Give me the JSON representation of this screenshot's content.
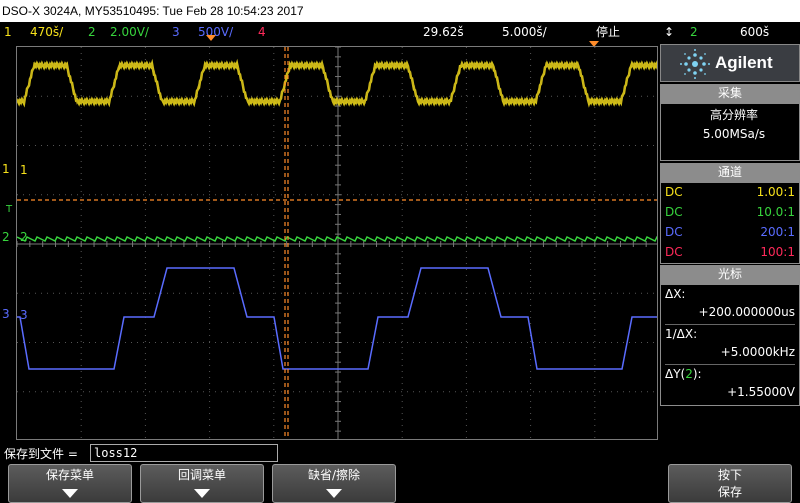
{
  "title": "DSO-X 3024A, MY53510495: Tue Feb 28 10:54:23 2017",
  "status": {
    "ch1_num": "1",
    "ch1_scale": "470š/",
    "ch2_num": "2",
    "ch2_scale": "2.00V/",
    "ch3_num": "3",
    "ch3_scale": "500V/",
    "ch4_num": "4",
    "time_delay": "29.62š",
    "time_scale": "5.000š/",
    "run_state": "停止",
    "trig_arrow": "↕",
    "trig_src": "2",
    "trig_level": "600š"
  },
  "markers": {
    "ch1": "1",
    "ch2": "2",
    "ch3": "3",
    "trig": "T"
  },
  "panel": {
    "brand": "Agilent",
    "acq_header": "采集",
    "acq_mode": "高分辨率",
    "acq_rate": "5.00MSa/s",
    "channels_header": "通道",
    "channels": [
      {
        "coupling": "DC",
        "ratio": "1.00:1",
        "color": "#f7e21b"
      },
      {
        "coupling": "DC",
        "ratio": "10.0:1",
        "color": "#37d43d"
      },
      {
        "coupling": "DC",
        "ratio": "200:1",
        "color": "#5a6cff"
      },
      {
        "coupling": "DC",
        "ratio": "100:1",
        "color": "#ff2a5a"
      }
    ],
    "cursor_header": "光标",
    "dx_label": "ΔX:",
    "dx_value": "+200.000000us",
    "inv_dx_label": "1/ΔX:",
    "inv_dx_value": "+5.0000kHz",
    "dy_label_pre": "ΔY(",
    "dy_label_ch": "2",
    "dy_label_post": "):",
    "dy_value": "+1.55000V"
  },
  "filename": {
    "label": "保存到文件 =",
    "value": "loss12"
  },
  "softkeys": {
    "save_menu": "保存菜单",
    "recall_menu": "回调菜单",
    "default_erase": "缺省/擦除",
    "press_save_line1": "按下",
    "press_save_line2": "保存"
  },
  "colors": {
    "ch1": "#f7e21b",
    "ch2": "#37d43d",
    "ch3": "#5a6cff",
    "ch4": "#ff2a5a",
    "cursor": "#ff8c2a"
  }
}
